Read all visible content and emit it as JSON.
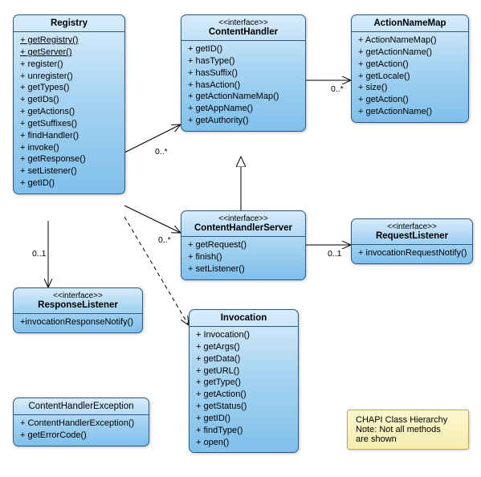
{
  "classes": {
    "registry": {
      "name": "Registry",
      "methods": [
        "+ getRegistry()",
        "+ getServer()",
        "+ register()",
        "+ unregister()",
        "+ getTypes()",
        "+ getIDs()",
        "+ getActions()",
        "+ getSuffixes()",
        "+ findHandler()",
        "+ invoke()",
        "+ getResponse()",
        "+ setListener()",
        "+ getID()"
      ]
    },
    "contentHandler": {
      "stereo": "<<interface>>",
      "name": "ContentHandler",
      "methods": [
        "+ getID()",
        "+ hasType()",
        "+ hasSuffix()",
        "+ hasAction()",
        "+ getActionNameMap()",
        "+ getAppName()",
        "+ getAuthority()"
      ]
    },
    "actionNameMap": {
      "name": "ActionNameMap",
      "methods": [
        "+ ActionNameMap()",
        "+ getActionName()",
        "+ getAction()",
        "+ getLocale()",
        "+ size()",
        "+ getAction()",
        "+ getActionName()"
      ]
    },
    "contentHandlerServer": {
      "stereo": "<<interface>>",
      "name": "ContentHandlerServer",
      "methods": [
        "+ getRequest()",
        "+ finish()",
        "+ setListener()"
      ]
    },
    "requestListener": {
      "stereo": "<<interface>>",
      "name": "RequestListener",
      "methods": [
        "+ invocationRequestNotify()"
      ]
    },
    "responseListener": {
      "stereo": "<<interface>>",
      "name": "ResponseListener",
      "methods": [
        "+invocationResponseNotify()"
      ]
    },
    "invocation": {
      "name": "Invocation",
      "methods": [
        "+ Invocation()",
        "+ getArgs()",
        "+ getData()",
        "+ getURL()",
        "+ getType()",
        "+ getAction()",
        "+ getStatus()",
        "+ getID()",
        "+ findType()",
        "+ open()"
      ]
    },
    "contentHandlerException": {
      "name": "ContentHandlerException",
      "methods": [
        "+ ContentHandlerException()",
        "+ getErrorCode()"
      ]
    }
  },
  "multiplicities": {
    "m1": "0..*",
    "m2": "0..*",
    "m3": "0..*",
    "m4": "0..1",
    "m5": "0..1"
  },
  "note": {
    "line1": "CHAPI Class Hierarchy",
    "line2": "Note: Not all methods",
    "line3": "are shown"
  },
  "chart_data": {
    "type": "uml-class-diagram",
    "title": "CHAPI Class Hierarchy",
    "classes": [
      {
        "name": "Registry",
        "kind": "class"
      },
      {
        "name": "ContentHandler",
        "kind": "interface"
      },
      {
        "name": "ActionNameMap",
        "kind": "class"
      },
      {
        "name": "ContentHandlerServer",
        "kind": "interface"
      },
      {
        "name": "RequestListener",
        "kind": "interface"
      },
      {
        "name": "ResponseListener",
        "kind": "interface"
      },
      {
        "name": "Invocation",
        "kind": "class"
      },
      {
        "name": "ContentHandlerException",
        "kind": "class"
      }
    ],
    "relationships": [
      {
        "from": "Registry",
        "to": "ContentHandler",
        "type": "association",
        "multiplicity": "0..*"
      },
      {
        "from": "Registry",
        "to": "ContentHandlerServer",
        "type": "association",
        "multiplicity": "0..*"
      },
      {
        "from": "Registry",
        "to": "ResponseListener",
        "type": "association",
        "multiplicity": "0..1"
      },
      {
        "from": "Registry",
        "to": "Invocation",
        "type": "dependency"
      },
      {
        "from": "ContentHandlerServer",
        "to": "ContentHandler",
        "type": "generalization"
      },
      {
        "from": "ContentHandler",
        "to": "ActionNameMap",
        "type": "association",
        "multiplicity": "0..*"
      },
      {
        "from": "ContentHandlerServer",
        "to": "RequestListener",
        "type": "association",
        "multiplicity": "0..1"
      }
    ]
  }
}
